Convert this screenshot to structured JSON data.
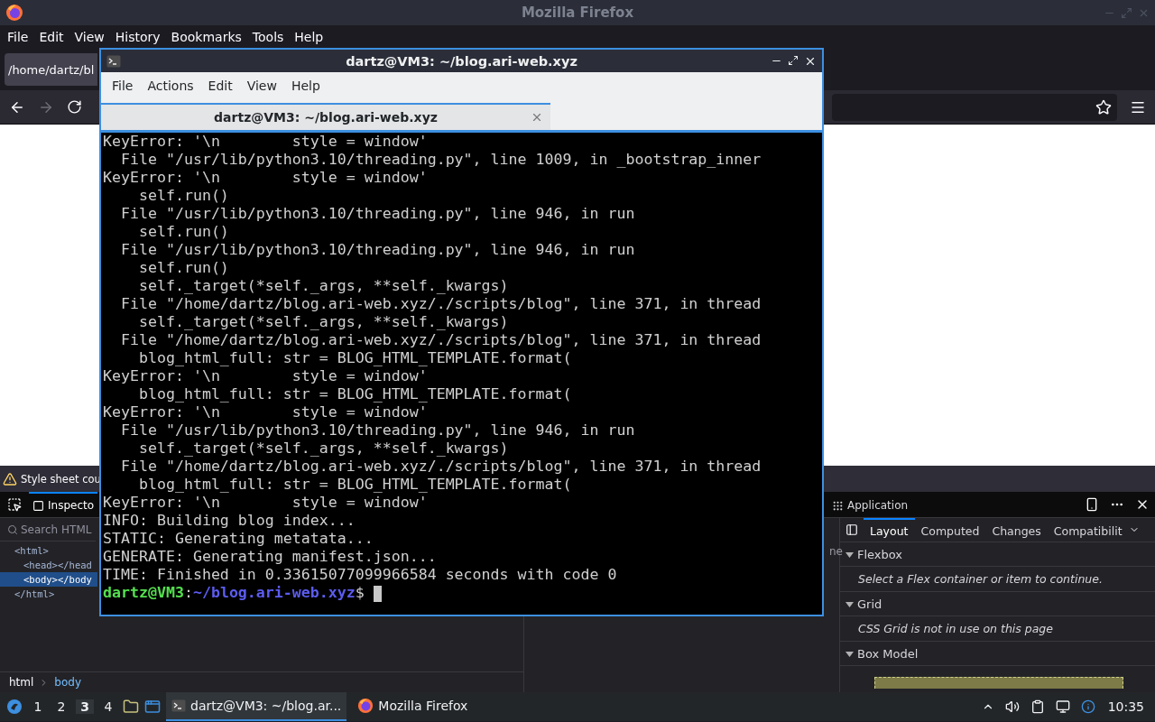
{
  "firefox": {
    "title": "Mozilla Firefox",
    "menu": [
      "File",
      "Edit",
      "View",
      "History",
      "Bookmarks",
      "Tools",
      "Help"
    ],
    "tab": {
      "label": "/home/dartz/bl"
    },
    "devtools": {
      "notification": "Style sheet cou",
      "tabs": [
        {
          "label": "Inspecto",
          "selected": true
        },
        {
          "label": "Application",
          "selected": false
        }
      ],
      "search": {
        "placeholder": "Search HTML"
      },
      "tree": [
        {
          "label": "<html>",
          "selected": false,
          "children": [
            {
              "label": "<head></head",
              "selected": false
            },
            {
              "label": "<body></body",
              "selected": true
            }
          ]
        },
        {
          "label": "</html>",
          "selected": false
        }
      ],
      "rules_fragment": "ne",
      "breadcrumbs": [
        {
          "label": "html",
          "selected": false
        },
        {
          "label": "body",
          "selected": true
        }
      ],
      "sidebar_tabs": [
        {
          "label": "Layout",
          "selected": true
        },
        {
          "label": "Computed",
          "selected": false
        },
        {
          "label": "Changes",
          "selected": false
        },
        {
          "label": "Compatibilit",
          "selected": false
        }
      ],
      "sections": [
        {
          "title": "Flexbox",
          "expanded": true,
          "message": "Select a Flex container or item to continue."
        },
        {
          "title": "Grid",
          "expanded": true,
          "message": "CSS Grid is not in use on this page"
        },
        {
          "title": "Box Model",
          "expanded": true
        }
      ]
    }
  },
  "terminal": {
    "title": "dartz@VM3: ~/blog.ari-web.xyz",
    "menu": [
      "File",
      "Actions",
      "Edit",
      "View",
      "Help"
    ],
    "tab": "dartz@VM3: ~/blog.ari-web.xyz",
    "lines": [
      "KeyError: '\\n        style = window'",
      "  File \"/usr/lib/python3.10/threading.py\", line 1009, in _bootstrap_inner",
      "KeyError: '\\n        style = window'",
      "    self.run()",
      "  File \"/usr/lib/python3.10/threading.py\", line 946, in run",
      "    self.run()",
      "  File \"/usr/lib/python3.10/threading.py\", line 946, in run",
      "    self.run()",
      "    self._target(*self._args, **self._kwargs)",
      "  File \"/home/dartz/blog.ari-web.xyz/./scripts/blog\", line 371, in thread",
      "    self._target(*self._args, **self._kwargs)",
      "  File \"/home/dartz/blog.ari-web.xyz/./scripts/blog\", line 371, in thread",
      "    blog_html_full: str = BLOG_HTML_TEMPLATE.format(",
      "KeyError: '\\n        style = window'",
      "    blog_html_full: str = BLOG_HTML_TEMPLATE.format(",
      "KeyError: '\\n        style = window'",
      "  File \"/usr/lib/python3.10/threading.py\", line 946, in run",
      "    self._target(*self._args, **self._kwargs)",
      "  File \"/home/dartz/blog.ari-web.xyz/./scripts/blog\", line 371, in thread",
      "    blog_html_full: str = BLOG_HTML_TEMPLATE.format(",
      "KeyError: '\\n        style = window'",
      "INFO: Building blog index...",
      "STATIC: Generating metatata...",
      "GENERATE: Generating manifest.json...",
      "TIME: Finished in 0.33615077099966584 seconds with code 0"
    ],
    "prompt": {
      "user": "dartz@VM3",
      "separator": ":",
      "path": "~/blog.ari-web.xyz",
      "symbol": "$"
    }
  },
  "taskbar": {
    "workspaces": [
      {
        "label": "1",
        "selected": false
      },
      {
        "label": "2",
        "selected": false
      },
      {
        "label": "3",
        "selected": true
      },
      {
        "label": "4",
        "selected": false
      }
    ],
    "tasks": [
      {
        "label": "dartz@VM3: ~/blog.ar...",
        "kind": "terminal",
        "selected": true
      },
      {
        "label": "Mozilla Firefox",
        "kind": "firefox",
        "selected": false
      }
    ],
    "clock": "10:35"
  }
}
